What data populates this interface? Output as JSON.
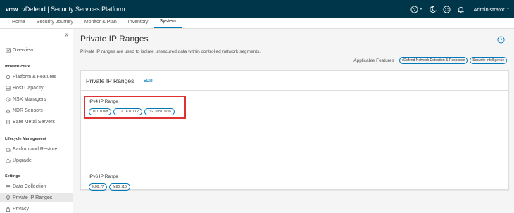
{
  "header": {
    "logo": "vmw",
    "title": "vDefend | Security Services Platform",
    "user": "Administrator"
  },
  "nav": {
    "tabs": [
      {
        "label": "Home"
      },
      {
        "label": "Security Journey"
      },
      {
        "label": "Monitor & Plan"
      },
      {
        "label": "Inventory"
      },
      {
        "label": "System"
      }
    ]
  },
  "sidebar": {
    "collapse": "«",
    "overview": "Overview",
    "sections": [
      {
        "heading": "Infrastructure",
        "items": [
          "Platform & Features",
          "Host Capacity",
          "NSX Managers",
          "NDR Sensors",
          "Bare Metal Servers"
        ]
      },
      {
        "heading": "Lifecycle Management",
        "items": [
          "Backup and Restore",
          "Upgrade"
        ]
      },
      {
        "heading": "Settings",
        "items": [
          "Data Collection",
          "Private IP Ranges",
          "Privacy"
        ]
      }
    ]
  },
  "main": {
    "title": "Private IP Ranges",
    "description": "Private IP ranges are used to isolate unsecured data within controlled network segments.",
    "features_label": "Applicable Features",
    "features": [
      "vDefend Network Detection & Response",
      "Security Intelligence"
    ],
    "card": {
      "title": "Private IP Ranges",
      "edit": "EDIT",
      "ipv4": {
        "title": "IPv4 IP Range",
        "ranges": [
          "10.0.0.0/8",
          "172.16.0.0/12",
          "192.168.0.0/16"
        ]
      },
      "ipv6": {
        "title": "IPv6 IP Range",
        "ranges": [
          "fc00::/7",
          "fe80::/10"
        ]
      }
    }
  }
}
